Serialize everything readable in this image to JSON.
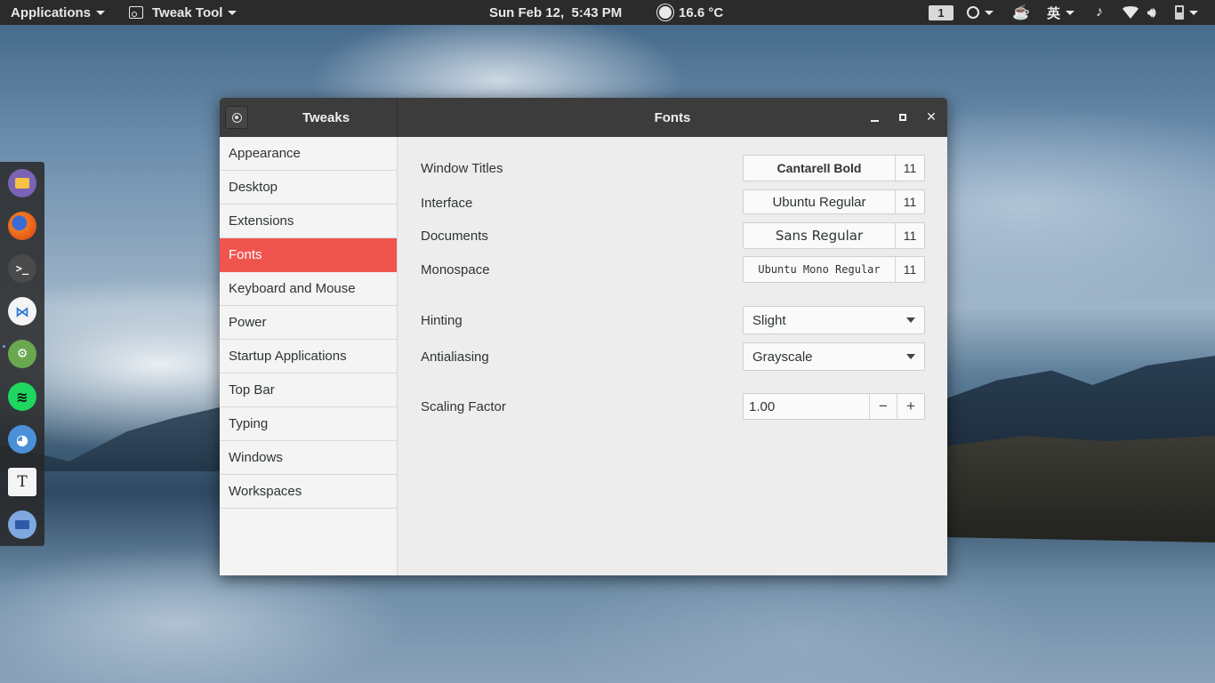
{
  "topbar": {
    "applications": "Applications",
    "app_menu": "Tweak Tool",
    "clock": "Sun Feb 12,  5:43 PM",
    "weather": "16.6 °C",
    "workspace": "1",
    "ime": "英"
  },
  "dock": {
    "items": [
      "files-icon",
      "firefox-icon",
      "terminal-icon",
      "vscode-icon",
      "android-icon",
      "spotify-icon",
      "bird-icon",
      "typora-icon",
      "show-desktop-icon"
    ]
  },
  "window": {
    "sidebar_title": "Tweaks",
    "title": "Fonts",
    "sidebar": [
      {
        "label": "Appearance"
      },
      {
        "label": "Desktop"
      },
      {
        "label": "Extensions"
      },
      {
        "label": "Fonts",
        "active": true
      },
      {
        "label": "Keyboard and Mouse"
      },
      {
        "label": "Power"
      },
      {
        "label": "Startup Applications"
      },
      {
        "label": "Top Bar"
      },
      {
        "label": "Typing"
      },
      {
        "label": "Windows"
      },
      {
        "label": "Workspaces"
      }
    ],
    "fonts": {
      "window_titles": {
        "label": "Window Titles",
        "font": "Cantarell Bold",
        "size": "11"
      },
      "interface": {
        "label": "Interface",
        "font": "Ubuntu Regular",
        "size": "11"
      },
      "documents": {
        "label": "Documents",
        "font": "Sans Regular",
        "size": "11"
      },
      "monospace": {
        "label": "Monospace",
        "font": "Ubuntu Mono Regular",
        "size": "11"
      }
    },
    "hinting": {
      "label": "Hinting",
      "value": "Slight"
    },
    "antialiasing": {
      "label": "Antialiasing",
      "value": "Grayscale"
    },
    "scaling": {
      "label": "Scaling Factor",
      "value": "1.00",
      "minus": "−",
      "plus": "+"
    }
  },
  "colors": {
    "accent": "#f0544f",
    "titlebar": "#3c3c3c",
    "topbar": "#2b2b2b"
  }
}
